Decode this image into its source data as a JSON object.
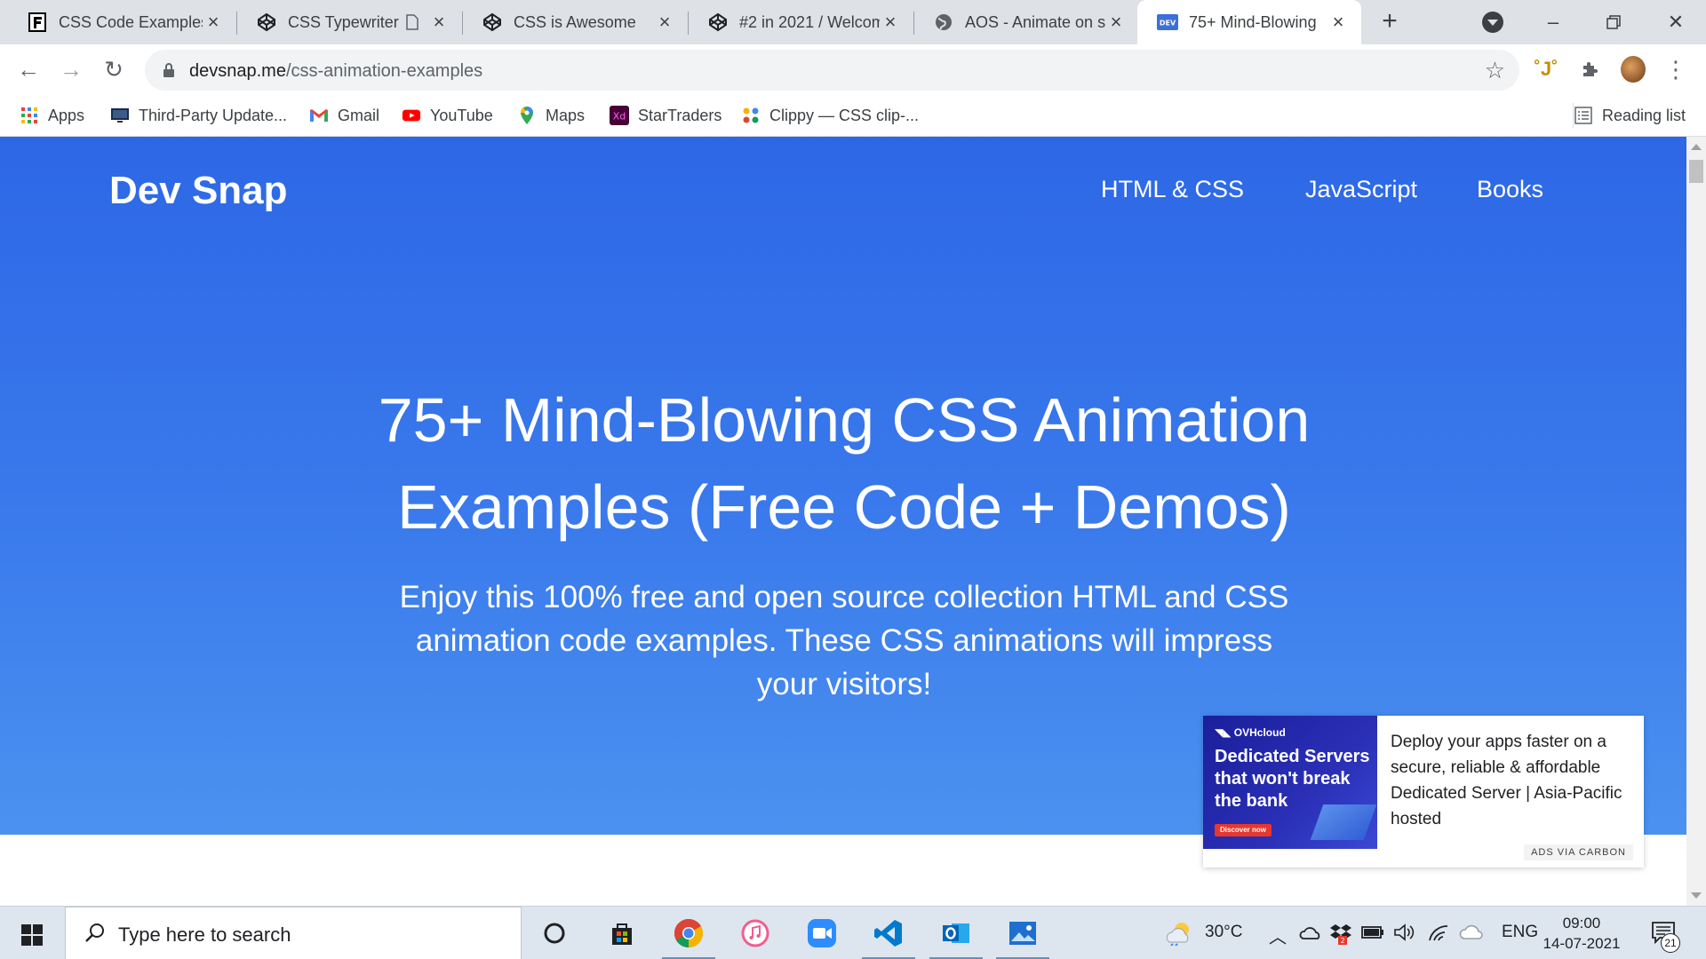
{
  "tabs": [
    {
      "title": "CSS Code Examples",
      "icon": "f-logo-icon"
    },
    {
      "title": "CSS Typewriter",
      "icon": "codepen-icon"
    },
    {
      "title": "CSS is Awesome",
      "icon": "codepen-icon"
    },
    {
      "title": "#2 in 2021 / Welcom",
      "icon": "codepen-icon"
    },
    {
      "title": "AOS - Animate on s",
      "icon": "globe-icon"
    },
    {
      "title": "75+ Mind-Blowing",
      "icon": "dev-logo-icon"
    }
  ],
  "toolbar": {
    "url_host": "devsnap.me",
    "url_path": "/css-animation-examples"
  },
  "bookmarks": [
    {
      "label": "Apps",
      "icon": "apps-grid-icon"
    },
    {
      "label": "Third-Party Update...",
      "icon": "monitor-icon"
    },
    {
      "label": "Gmail",
      "icon": "gmail-icon"
    },
    {
      "label": "YouTube",
      "icon": "youtube-icon"
    },
    {
      "label": "Maps",
      "icon": "maps-icon"
    },
    {
      "label": "StarTraders",
      "icon": "xd-icon"
    },
    {
      "label": "Clippy — CSS clip-...",
      "icon": "clippy-icon"
    }
  ],
  "reading_list": "Reading list",
  "site": {
    "brand": "Dev Snap",
    "nav": [
      "HTML & CSS",
      "JavaScript",
      "Books"
    ],
    "headline_line1": "75+ Mind-Blowing CSS Animation",
    "headline_line2": "Examples (Free Code + Demos)",
    "subtext": "Enjoy this 100% free and open source collection HTML and CSS animation code examples. These CSS animations will impress your visitors!"
  },
  "ad": {
    "brand": "OVHcloud",
    "image_headline": "Dedicated Servers that won't break the bank",
    "cta": "Discover now",
    "text": "Deploy your apps faster on a secure, reliable & affordable Dedicated Server | Asia-Pacific hosted",
    "via": "ADS VIA CARBON"
  },
  "taskbar": {
    "search_placeholder": "Type here to search",
    "weather": "30°C",
    "language": "ENG",
    "time": "09:00",
    "date": "14-07-2021",
    "notification_count": "21"
  },
  "colors": {
    "hero_top": "#2d67e6",
    "hero_bottom": "#4b92f0",
    "ad_image": "#1a1f9b"
  }
}
